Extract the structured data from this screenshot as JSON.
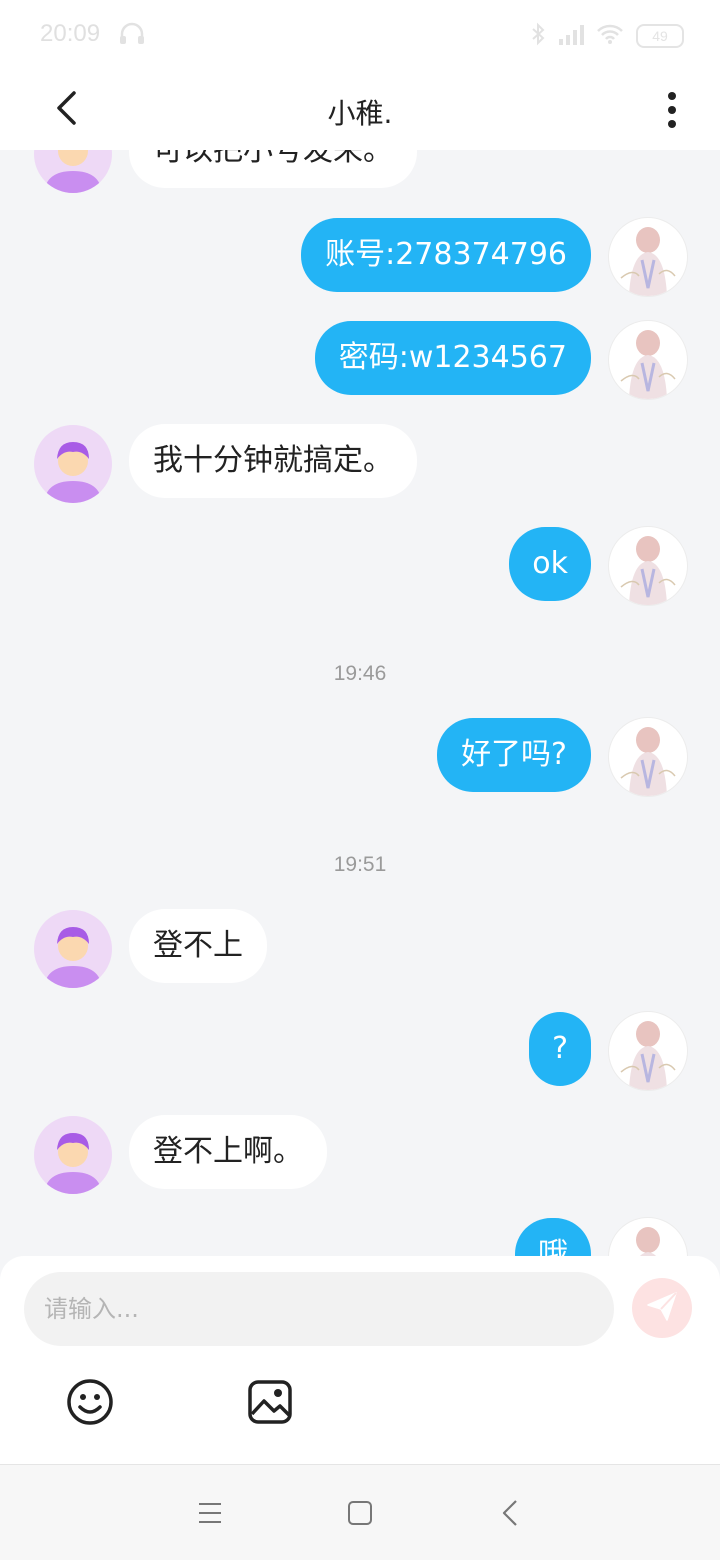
{
  "status": {
    "time": "20:09",
    "battery": "49"
  },
  "header": {
    "title": "小稚."
  },
  "messages": {
    "m0": "可以把小号发来。",
    "m1": "账号:278374796",
    "m2": "密码:w1234567",
    "m3": "我十分钟就搞定。",
    "m4": "ok",
    "ts1": "19:46",
    "m5": "好了吗?",
    "ts2": "19:51",
    "m6": "登不上",
    "m7": "?",
    "m8": "登不上啊。",
    "m9": "哦"
  },
  "input": {
    "placeholder": "请输入..."
  },
  "colors": {
    "outgoing": "#23b4f5",
    "incoming": "#ffffff",
    "send_disabled": "#fde2e2",
    "avatar_bg": "#eed9f6"
  },
  "icons": {
    "back": "chevron-left-icon",
    "more": "more-vertical-icon",
    "send": "send-icon",
    "emoji": "smiley-icon",
    "image": "image-icon"
  }
}
